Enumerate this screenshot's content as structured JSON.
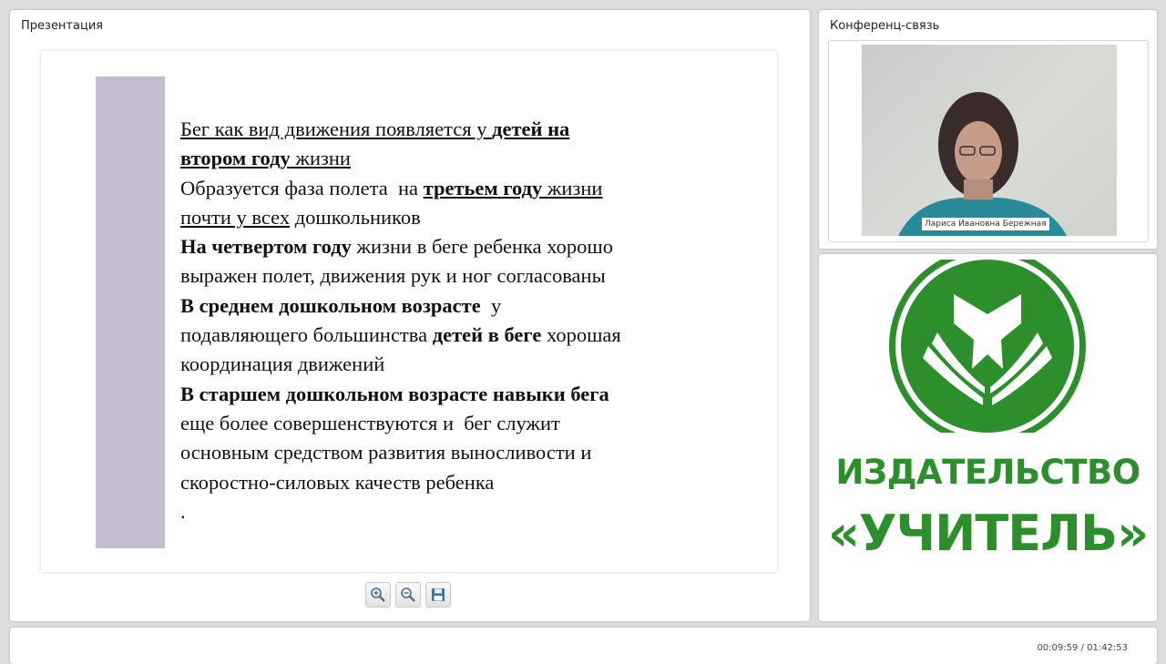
{
  "presentation": {
    "title": "Презентация",
    "slide": {
      "lines": [
        [
          {
            "t": "Бег как вид движения появляется у ",
            "u": true
          },
          {
            "t": "детей на",
            "u": true,
            "b": true
          }
        ],
        [
          {
            "t": "втором году",
            "u": true,
            "b": true
          },
          {
            "t": " жизни",
            "u": true
          }
        ],
        [
          {
            "t": "Образуется фаза полета  на "
          },
          {
            "t": "третьем году",
            "u": true,
            "b": true
          },
          {
            "t": " жизни",
            "u": true
          }
        ],
        [
          {
            "t": "почти у всех",
            "u": true
          },
          {
            "t": " дошкольников"
          }
        ],
        [
          {
            "t": "На четвертом году",
            "b": true
          },
          {
            "t": " жизни в беге ребенка хорошо"
          }
        ],
        [
          {
            "t": "выражен полет, движения рук и ног согласованы"
          }
        ],
        [
          {
            "t": "В среднем дошкольном возрасте",
            "b": true
          },
          {
            "t": "  у"
          }
        ],
        [
          {
            "t": "подавляющего большинства "
          },
          {
            "t": "детей в беге",
            "b": true
          },
          {
            "t": " хорошая"
          }
        ],
        [
          {
            "t": "координация движений"
          }
        ],
        [
          {
            "t": "В старшем дошкольном возрасте навыки бега",
            "b": true
          }
        ],
        [
          {
            "t": "еще более совершенствуются и  бег служит"
          }
        ],
        [
          {
            "t": "основным средством развития выносливости и"
          }
        ],
        [
          {
            "t": "скоростно-силовых качеств ребенка"
          }
        ],
        [
          {
            "t": "."
          }
        ]
      ]
    },
    "toolbar": {
      "zoom_in_icon": "zoom-in-icon",
      "zoom_out_icon": "zoom-out-icon",
      "save_icon": "floppy-disk-icon"
    }
  },
  "conference": {
    "title": "Конференц-связь",
    "speaker_name": "Лариса Ивановна Бережная"
  },
  "logo": {
    "line1": "ИЗДАТЕЛЬСТВО",
    "line2": "«УЧИТЕЛЬ»",
    "color": "#2c8f2c"
  },
  "timer": "00:09:59 / 01:42:53"
}
